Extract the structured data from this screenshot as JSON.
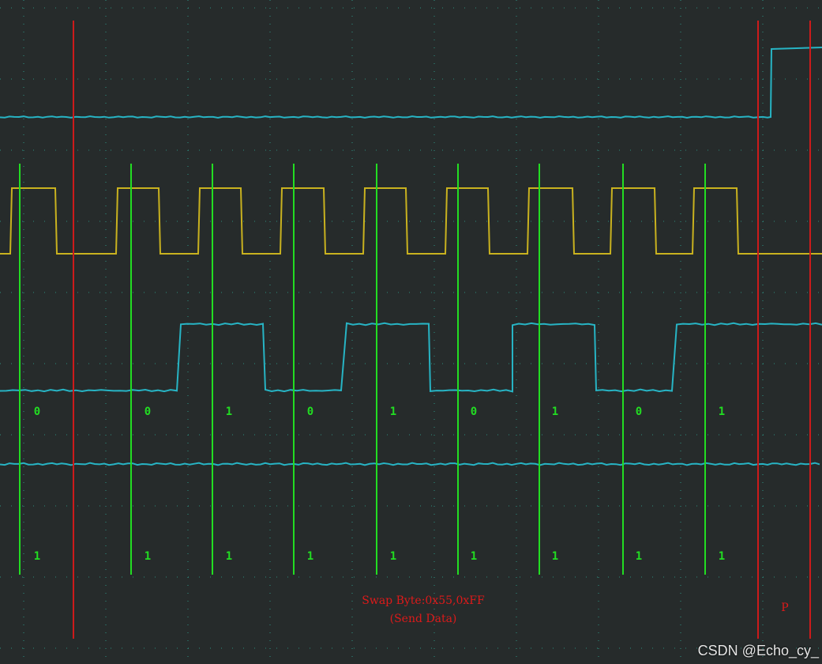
{
  "screen": {
    "background": "#262b2b",
    "grid_color": "#2f9a8a"
  },
  "colors": {
    "sck": "#c9b21f",
    "mosi": "#27b4c4",
    "miso": "#27b4c4",
    "cs": "#27b4c4",
    "sample_marker": "#22dd22",
    "frame_marker": "#cc1b1b",
    "annotation": "#dd1a1a",
    "watermark": "#e6e6e6"
  },
  "bits": {
    "mosi": [
      "0",
      "0",
      "1",
      "0",
      "1",
      "0",
      "1",
      "0",
      "1"
    ],
    "miso": [
      "1",
      "1",
      "1",
      "1",
      "1",
      "1",
      "1",
      "1",
      "1"
    ]
  },
  "annotation": {
    "line1": "Swap Byte:0x55,0xFF",
    "line2": "(Send Data)",
    "stop_marker": "P"
  },
  "watermark": "CSDN @Echo_cy_"
}
